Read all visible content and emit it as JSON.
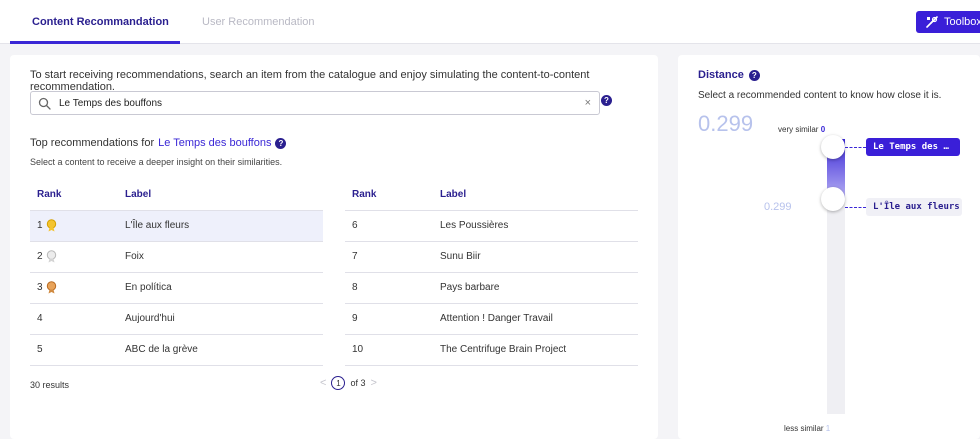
{
  "tabs": [
    {
      "label": "Content Recommandation",
      "active": true
    },
    {
      "label": "User Recommendation",
      "active": false
    }
  ],
  "toolbox": {
    "label": "Toolbox",
    "icon": "tools-icon"
  },
  "left": {
    "intro": "To start receiving recommendations, search an item from the catalogue and enjoy simulating the content-to-content recommendation.",
    "search": {
      "value": "Le Temps des bouffons",
      "clear": "×"
    },
    "rec_title_prefix": "Top recommendations for",
    "rec_title_item": "Le Temps des bouffons",
    "rec_sub": "Select a content to receive a deeper insight on their similarities.",
    "columns": {
      "rank": "Rank",
      "label": "Label"
    },
    "rows_a": [
      {
        "rank": "1",
        "label": "L'Île aux fleurs",
        "medal": "gold"
      },
      {
        "rank": "2",
        "label": "Foix",
        "medal": "silver"
      },
      {
        "rank": "3",
        "label": "En política",
        "medal": "bronze"
      },
      {
        "rank": "4",
        "label": "Aujourd'hui",
        "medal": ""
      },
      {
        "rank": "5",
        "label": "ABC de la grève",
        "medal": ""
      }
    ],
    "rows_b": [
      {
        "rank": "6",
        "label": "Les Poussières"
      },
      {
        "rank": "7",
        "label": "Sunu Biir"
      },
      {
        "rank": "8",
        "label": "Pays barbare"
      },
      {
        "rank": "9",
        "label": "Attention ! Danger Travail"
      },
      {
        "rank": "10",
        "label": "The Centrifuge Brain Project"
      }
    ],
    "results": "30 results",
    "pager": {
      "prev": "<",
      "current": "1",
      "of": "of 3",
      "next": ">"
    }
  },
  "right": {
    "title": "Distance",
    "subtitle": "Select a recommended content to know how close it is.",
    "big_value": "0.299",
    "very_similar_label": "very similar",
    "very_similar_value": "0",
    "less_similar_label": "less similar",
    "less_similar_value": "1",
    "mid_value": "0.299",
    "selected_distance": 0.299,
    "tag_top": "Le Temps des …",
    "tag_mid": "L'Île aux fleurs",
    "accent": "#3a27d6"
  }
}
